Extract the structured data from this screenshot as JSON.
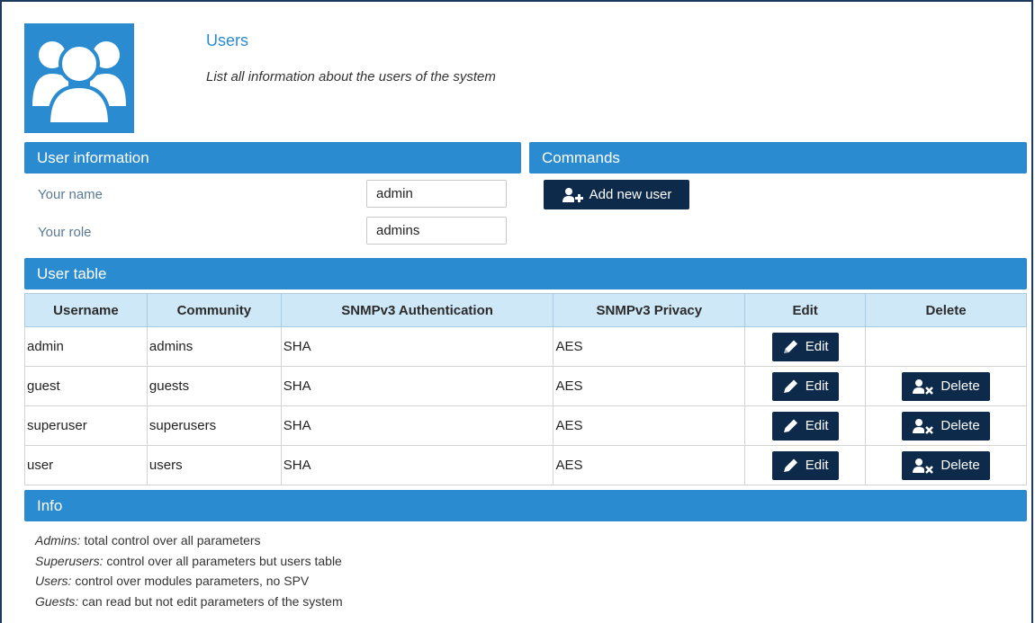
{
  "header": {
    "title": "Users",
    "description": "List all information about the users of the system",
    "icon": "users-group-icon",
    "accent_color": "#2a8bd0"
  },
  "user_information": {
    "title": "User information",
    "name_label": "Your name",
    "name_value": "admin",
    "role_label": "Your role",
    "role_value": "admins"
  },
  "commands": {
    "title": "Commands",
    "add_user_label": "Add new user",
    "add_user_icon": "user-plus-icon"
  },
  "user_table": {
    "title": "User table",
    "columns": [
      "Username",
      "Community",
      "SNMPv3 Authentication",
      "SNMPv3 Privacy",
      "Edit",
      "Delete"
    ],
    "edit_label": "Edit",
    "delete_label": "Delete",
    "rows": [
      {
        "username": "admin",
        "community": "admins",
        "auth": "SHA",
        "privacy": "AES",
        "deletable": false
      },
      {
        "username": "guest",
        "community": "guests",
        "auth": "SHA",
        "privacy": "AES",
        "deletable": true
      },
      {
        "username": "superuser",
        "community": "superusers",
        "auth": "SHA",
        "privacy": "AES",
        "deletable": true
      },
      {
        "username": "user",
        "community": "users",
        "auth": "SHA",
        "privacy": "AES",
        "deletable": true
      }
    ]
  },
  "info": {
    "title": "Info",
    "items": [
      {
        "role": "Admins:",
        "text": " total control over all parameters"
      },
      {
        "role": "Superusers:",
        "text": " control over all parameters but users table"
      },
      {
        "role": "Users:",
        "text": " control over modules parameters, no SPV"
      },
      {
        "role": "Guests:",
        "text": " can read but not edit parameters of the system"
      }
    ]
  },
  "colors": {
    "panel_header": "#2a8bd0",
    "button_dark": "#0d2a4a",
    "table_header_bg": "#cfe8f8"
  }
}
